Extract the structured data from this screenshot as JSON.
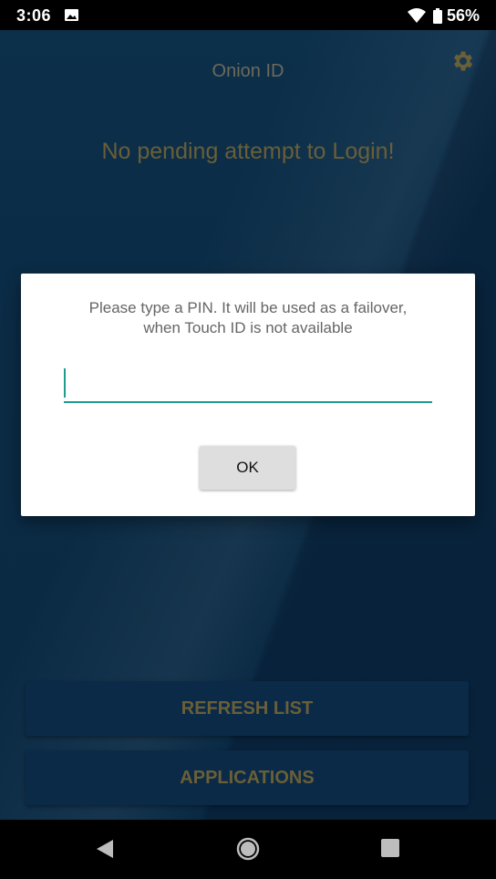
{
  "status_bar": {
    "time": "3:06",
    "battery_percent": "56%",
    "icons": [
      "image-icon",
      "wifi-icon",
      "battery-icon"
    ]
  },
  "app": {
    "title": "Onion ID",
    "message": "No pending attempt to Login!",
    "settings_icon": "gear-icon",
    "buttons": {
      "refresh": "REFRESH LIST",
      "applications": "APPLICATIONS"
    }
  },
  "dialog": {
    "message_line1": "Please type a PIN. It will be used as a failover,",
    "message_line2": "when Touch ID is not available",
    "pin_value": "",
    "ok_label": "OK"
  },
  "nav_bar": {
    "icons": [
      "back-icon",
      "home-icon",
      "recent-apps-icon"
    ]
  },
  "colors": {
    "accent": "#1f9a8e",
    "background": "#0b2d48",
    "muted_text": "#6a5f37"
  }
}
